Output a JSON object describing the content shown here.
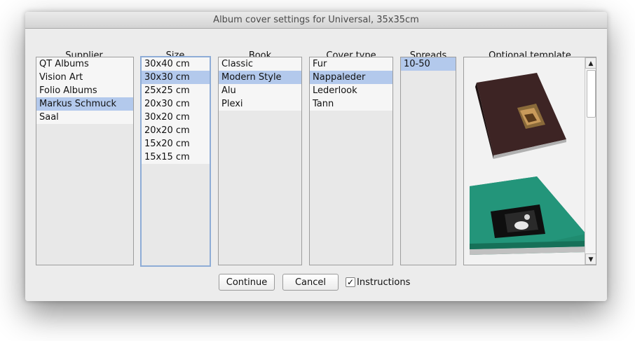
{
  "window": {
    "title": "Album cover settings for Universal, 35x35cm"
  },
  "columns": {
    "supplier": {
      "header": "Supplier",
      "items": [
        "QT Albums",
        "Vision Art",
        "Folio Albums",
        "Markus Schmuck",
        "Saal"
      ],
      "selected": "Markus Schmuck"
    },
    "size": {
      "header": "Size",
      "items": [
        "30x40 cm",
        "30x30 cm",
        "25x25 cm",
        "20x30 cm",
        "30x20 cm",
        "20x20 cm",
        "15x20 cm",
        "15x15 cm"
      ],
      "selected": "30x30 cm"
    },
    "book": {
      "header": "Book",
      "items": [
        "Classic",
        "Modern Style",
        "Alu",
        "Plexi"
      ],
      "selected": "Modern Style"
    },
    "cover_type": {
      "header": "Cover type",
      "items": [
        "Fur",
        "Nappaleder",
        "Lederlook",
        "Tann"
      ],
      "selected": "Nappaleder"
    },
    "spreads": {
      "header": "Spreads",
      "items": [
        "10-50"
      ],
      "selected": "10-50"
    },
    "template": {
      "header": "Optional template",
      "thumbnails": [
        {
          "icon": "album-brown-cover-icon",
          "color": "#4a2a2a"
        },
        {
          "icon": "album-teal-cover-icon",
          "color": "#1a8a6e"
        }
      ]
    }
  },
  "buttons": {
    "continue": "Continue",
    "cancel": "Cancel"
  },
  "instructions": {
    "label": "Instructions",
    "checked": true
  },
  "scrollbar": {
    "up_icon": "scroll-up-arrow-icon",
    "down_icon": "scroll-down-arrow-icon"
  }
}
